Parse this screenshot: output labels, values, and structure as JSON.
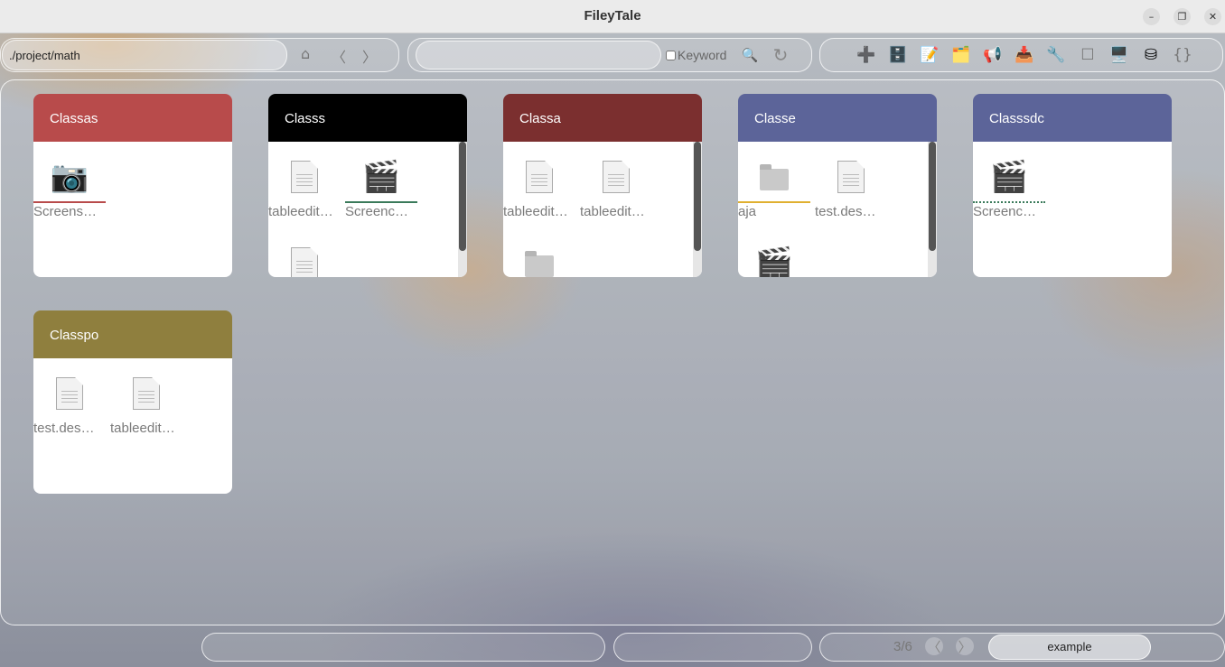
{
  "app": {
    "title": "FileyTale"
  },
  "window_controls": {
    "minimize": "–",
    "maximize": "❐",
    "close": "✕"
  },
  "toolbar": {
    "path": "./project/math",
    "home_icon": "⌂",
    "back_icon": "〈",
    "forward_icon": "〉",
    "search_placeholder": "",
    "keyword_label": "Keyword",
    "search_icon": "🔍",
    "refresh_icon": "↻",
    "tools": [
      {
        "name": "add-icon",
        "glyph": "➕"
      },
      {
        "name": "cabinet-icon",
        "glyph": "🗄️"
      },
      {
        "name": "memo-icon",
        "glyph": "📝"
      },
      {
        "name": "card-index-icon",
        "glyph": "🗂️"
      },
      {
        "name": "megaphone-icon",
        "glyph": "📢"
      },
      {
        "name": "inbox-tray-icon",
        "glyph": "📥"
      },
      {
        "name": "wrench-icon",
        "glyph": "🔧"
      },
      {
        "name": "square-icon",
        "glyph": "☐"
      },
      {
        "name": "desktop-computer-icon",
        "glyph": "🖥️"
      },
      {
        "name": "database-icon",
        "glyph": "⛁"
      },
      {
        "name": "braces-icon",
        "glyph": "{}"
      }
    ]
  },
  "cards": [
    {
      "title": "Classas",
      "color": "#b84b4b",
      "scroll": false,
      "items": [
        {
          "type": "camera",
          "label": "Screens…",
          "underline": "#b84b4b",
          "style": "solid"
        }
      ]
    },
    {
      "title": "Classs",
      "color": "#000000",
      "scroll": true,
      "items": [
        {
          "type": "doc",
          "label": "tableedit…",
          "underline": "",
          "style": "solid"
        },
        {
          "type": "clapper",
          "label": "Screenc…",
          "underline": "#3a7a5a",
          "style": "solid"
        },
        {
          "type": "doc",
          "label": "",
          "underline": "",
          "style": "solid"
        }
      ]
    },
    {
      "title": "Classa",
      "color": "#7b2f2f",
      "scroll": true,
      "items": [
        {
          "type": "doc",
          "label": "tableedit…",
          "underline": "",
          "style": "solid"
        },
        {
          "type": "doc",
          "label": "tableedit…",
          "underline": "",
          "style": "solid"
        },
        {
          "type": "folder",
          "label": "",
          "underline": "",
          "style": "solid"
        }
      ]
    },
    {
      "title": "Classe",
      "color": "#5c6499",
      "scroll": true,
      "items": [
        {
          "type": "folder",
          "label": "aja",
          "underline": "#e0b030",
          "style": "solid"
        },
        {
          "type": "doc",
          "label": "test.des…",
          "underline": "",
          "style": "solid"
        },
        {
          "type": "clapper",
          "label": "",
          "underline": "",
          "style": "solid"
        }
      ]
    },
    {
      "title": "Classsdc",
      "color": "#5c6499",
      "scroll": false,
      "items": [
        {
          "type": "clapper",
          "label": "Screenc…",
          "underline": "#3a7a5a",
          "style": "dotted"
        }
      ]
    },
    {
      "title": "Classpo",
      "color": "#8f7f3e",
      "scroll": false,
      "items": [
        {
          "type": "doc",
          "label": "test.des…",
          "underline": "",
          "style": "solid"
        },
        {
          "type": "doc",
          "label": "tableedit…",
          "underline": "",
          "style": "solid"
        }
      ]
    }
  ],
  "footer": {
    "page_indicator": "3/6",
    "prev_icon": "〈",
    "next_icon": "〉",
    "example_label": "example"
  }
}
